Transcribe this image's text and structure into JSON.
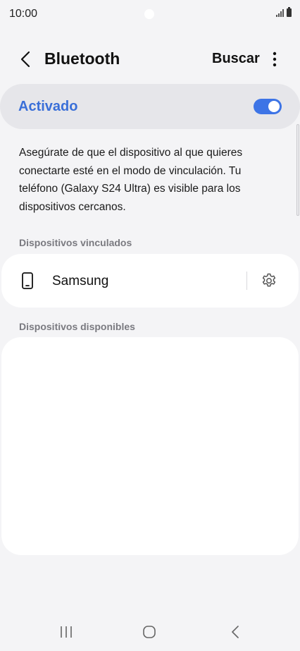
{
  "status_bar": {
    "time": "10:00"
  },
  "header": {
    "title": "Bluetooth",
    "search_label": "Buscar",
    "back_icon": "chevron-left-icon",
    "more_icon": "more-vertical-icon"
  },
  "bluetooth_toggle": {
    "label": "Activado",
    "enabled": true,
    "accent_color": "#3d74e6"
  },
  "description": "Asegúrate de que el dispositivo al que quieres conectarte esté en el modo de vinculación. Tu teléfono (Galaxy S24 Ultra) es visible para los dispositivos cercanos.",
  "paired_devices": {
    "label": "Dispositivos vinculados",
    "items": [
      {
        "name": "Samsung",
        "icon": "phone-icon",
        "settings_icon": "gear-icon"
      }
    ]
  },
  "available_devices": {
    "label": "Dispositivos disponibles",
    "items": []
  },
  "nav_bar": {
    "recents_icon": "recents-icon",
    "home_icon": "home-icon",
    "back_icon": "back-icon"
  }
}
